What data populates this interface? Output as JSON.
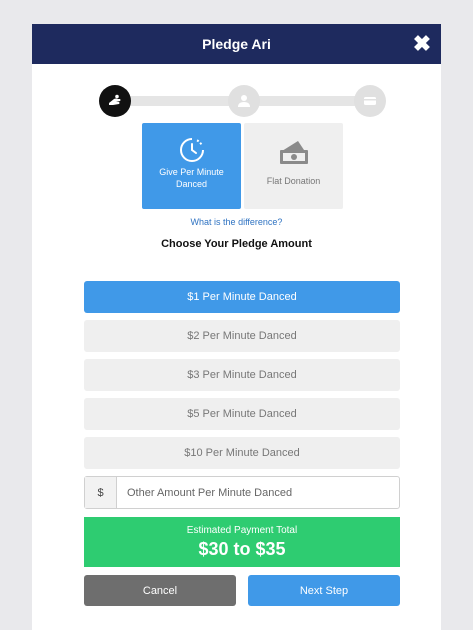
{
  "header": {
    "title": "Pledge Ari"
  },
  "steps": [
    {
      "icon": "hand-icon",
      "state": "active"
    },
    {
      "icon": "user-icon",
      "state": "inactive"
    },
    {
      "icon": "card-icon",
      "state": "inactive"
    }
  ],
  "pledge_types": {
    "per_minute": {
      "label": "Give Per Minute Danced",
      "icon": "clock-icon",
      "selected": true
    },
    "flat": {
      "label": "Flat Donation",
      "icon": "cash-icon",
      "selected": false
    }
  },
  "difference_link": "What is the difference?",
  "section_title": "Choose Your Pledge Amount",
  "options": [
    {
      "label": "$1 Per Minute Danced",
      "selected": true
    },
    {
      "label": "$2 Per Minute Danced",
      "selected": false
    },
    {
      "label": "$3 Per Minute Danced",
      "selected": false
    },
    {
      "label": "$5 Per Minute Danced",
      "selected": false
    },
    {
      "label": "$10 Per Minute Danced",
      "selected": false
    }
  ],
  "other_amount": {
    "currency_symbol": "$",
    "placeholder": "Other Amount Per Minute Danced",
    "value": ""
  },
  "estimate": {
    "label": "Estimated Payment Total",
    "value": "$30 to $35"
  },
  "buttons": {
    "cancel": "Cancel",
    "next": "Next Step"
  },
  "colors": {
    "header": "#1e2a5e",
    "accent": "#4099e8",
    "success": "#2ecc71",
    "cancel": "#6e6e6e"
  }
}
